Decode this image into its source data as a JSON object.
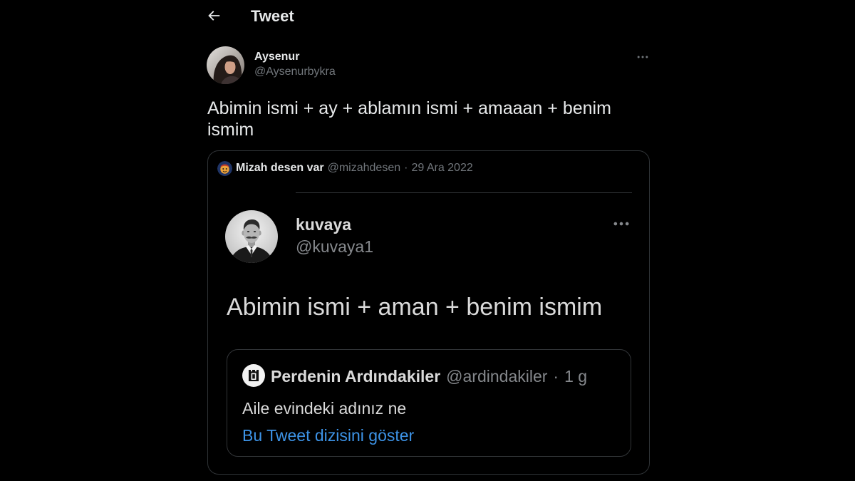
{
  "colors": {
    "background": "#000000",
    "text_primary": "#e7e9ea",
    "text_secondary": "#71767b",
    "border": "#2f3336",
    "link": "#3d93e6"
  },
  "header": {
    "back_icon": "arrow-left-icon",
    "title": "Tweet"
  },
  "tweet": {
    "author": {
      "name": "Aysenur",
      "handle": "@Aysenurbykra"
    },
    "more_icon": "more-icon",
    "text": "Abimin ismi + ay + ablamın ismi + amaaan + benim ismim",
    "quote": {
      "author": {
        "name": "Mizah desen var",
        "handle": "@mizahdesen"
      },
      "separator": "·",
      "date": "29 Ara 2022",
      "image": {
        "author": {
          "name": "kuvaya",
          "handle": "@kuvaya1"
        },
        "more_icon": "more-icon",
        "text": "Abimin ismi + aman + benim ismim",
        "quoted_tweet": {
          "icon": "castle-logo-icon",
          "author": {
            "name": "Perdenin Ardındakiler",
            "handle": "@ardindakiler"
          },
          "separator": "·",
          "time": "1 g",
          "text": "Aile evindeki adınız ne",
          "show_thread_link": "Bu Tweet dizisini göster"
        }
      }
    }
  }
}
